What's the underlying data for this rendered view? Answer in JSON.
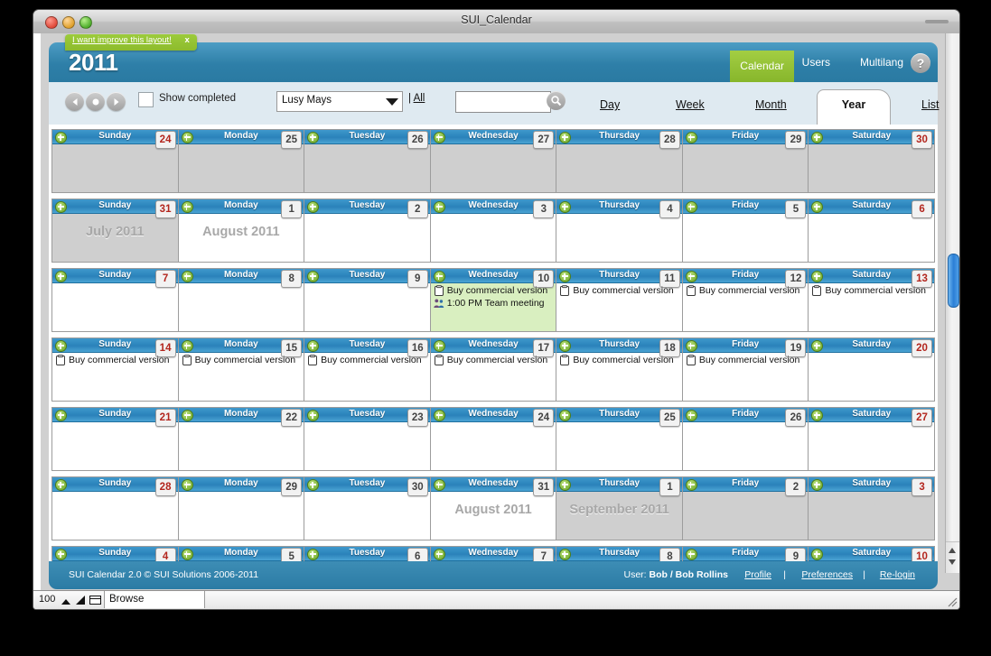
{
  "window": {
    "title": "SUI_Calendar",
    "controls": [
      "close",
      "minimize",
      "maximize"
    ]
  },
  "statusbar": {
    "zoom": "100",
    "mode": "Browse",
    "icons": [
      "zoom-out-icon",
      "zoom-in-icon",
      "toggle-window-icon",
      "resize-grip-icon"
    ]
  },
  "app": {
    "promo": {
      "text": "I want improve this layout!",
      "close": "x"
    },
    "year": "2011",
    "nav": [
      {
        "name": "calendar",
        "label": "Calendar",
        "active": true
      },
      {
        "name": "users",
        "label": "Users",
        "active": false
      },
      {
        "name": "multilang",
        "label": "Multilang",
        "active": false
      }
    ],
    "help_label": "?",
    "toolbar": {
      "prev_icon": "previous-arrow-icon",
      "today_icon": "today-dot-icon",
      "next_icon": "next-arrow-icon",
      "show_completed_label": "Show completed",
      "show_completed_checked": false,
      "user_select_value": "Lusy Mays",
      "user_select_options": [
        "Lusy Mays"
      ],
      "all_link": "| All",
      "all_link_text": "All",
      "search_value": "",
      "search_placeholder": "",
      "search_icon": "search-icon"
    },
    "view_tabs": [
      {
        "name": "day",
        "label": "Day",
        "active": false
      },
      {
        "name": "week",
        "label": "Week",
        "active": false
      },
      {
        "name": "month",
        "label": "Month",
        "active": false
      },
      {
        "name": "year",
        "label": "Year",
        "active": true
      },
      {
        "name": "list",
        "label": "List",
        "active": false
      }
    ],
    "footer": {
      "copyright": "SUI Calendar 2.0 © SUI Solutions 2006-2011",
      "user_prefix": "User:",
      "user_name": "Bob / Bob Rollins",
      "profile": "Profile",
      "sep1": "|",
      "preferences": "Preferences",
      "sep2": "|",
      "relogin": "Re-login"
    }
  },
  "calendar": {
    "daynames": [
      "Sunday",
      "Monday",
      "Tuesday",
      "Wednesday",
      "Thursday",
      "Friday",
      "Saturday"
    ],
    "add_icon": "plus-icon",
    "weeks": [
      {
        "days": [
          {
            "num": "24",
            "state": "grey",
            "weekend": true,
            "month_label": "",
            "events": []
          },
          {
            "num": "25",
            "state": "grey",
            "weekend": false,
            "month_label": "",
            "events": []
          },
          {
            "num": "26",
            "state": "grey",
            "weekend": false,
            "month_label": "",
            "events": []
          },
          {
            "num": "27",
            "state": "grey",
            "weekend": false,
            "month_label": "",
            "events": []
          },
          {
            "num": "28",
            "state": "grey",
            "weekend": false,
            "month_label": "",
            "events": []
          },
          {
            "num": "29",
            "state": "grey",
            "weekend": false,
            "month_label": "",
            "events": []
          },
          {
            "num": "30",
            "state": "grey",
            "weekend": true,
            "month_label": "",
            "events": []
          }
        ]
      },
      {
        "days": [
          {
            "num": "31",
            "state": "grey",
            "weekend": true,
            "month_label": "July 2011",
            "events": []
          },
          {
            "num": "1",
            "state": "normal",
            "weekend": false,
            "month_label": "August 2011",
            "events": []
          },
          {
            "num": "2",
            "state": "normal",
            "weekend": false,
            "month_label": "",
            "events": []
          },
          {
            "num": "3",
            "state": "normal",
            "weekend": false,
            "month_label": "",
            "events": []
          },
          {
            "num": "4",
            "state": "normal",
            "weekend": false,
            "month_label": "",
            "events": []
          },
          {
            "num": "5",
            "state": "normal",
            "weekend": false,
            "month_label": "",
            "events": []
          },
          {
            "num": "6",
            "state": "normal",
            "weekend": true,
            "month_label": "",
            "events": []
          }
        ]
      },
      {
        "days": [
          {
            "num": "7",
            "state": "normal",
            "weekend": true,
            "month_label": "",
            "events": []
          },
          {
            "num": "8",
            "state": "normal",
            "weekend": false,
            "month_label": "",
            "events": []
          },
          {
            "num": "9",
            "state": "normal",
            "weekend": false,
            "month_label": "",
            "events": []
          },
          {
            "num": "10",
            "state": "today",
            "weekend": false,
            "month_label": "",
            "events": [
              {
                "icon": "clipboard-icon",
                "text": "Buy commercial version"
              },
              {
                "icon": "people-icon",
                "text": "1:00 PM Team meeting"
              }
            ]
          },
          {
            "num": "11",
            "state": "normal",
            "weekend": false,
            "month_label": "",
            "events": [
              {
                "icon": "clipboard-icon",
                "text": "Buy commercial version"
              }
            ]
          },
          {
            "num": "12",
            "state": "normal",
            "weekend": false,
            "month_label": "",
            "events": [
              {
                "icon": "clipboard-icon",
                "text": "Buy commercial version"
              }
            ]
          },
          {
            "num": "13",
            "state": "normal",
            "weekend": true,
            "month_label": "",
            "events": [
              {
                "icon": "clipboard-icon",
                "text": "Buy commercial version"
              }
            ]
          }
        ]
      },
      {
        "days": [
          {
            "num": "14",
            "state": "normal",
            "weekend": true,
            "month_label": "",
            "events": [
              {
                "icon": "clipboard-icon",
                "text": "Buy commercial version"
              }
            ]
          },
          {
            "num": "15",
            "state": "normal",
            "weekend": false,
            "month_label": "",
            "events": [
              {
                "icon": "clipboard-icon",
                "text": "Buy commercial version"
              }
            ]
          },
          {
            "num": "16",
            "state": "normal",
            "weekend": false,
            "month_label": "",
            "events": [
              {
                "icon": "clipboard-icon",
                "text": "Buy commercial version"
              }
            ]
          },
          {
            "num": "17",
            "state": "normal",
            "weekend": false,
            "month_label": "",
            "events": [
              {
                "icon": "clipboard-icon",
                "text": "Buy commercial version"
              }
            ]
          },
          {
            "num": "18",
            "state": "normal",
            "weekend": false,
            "month_label": "",
            "events": [
              {
                "icon": "clipboard-icon",
                "text": "Buy commercial version"
              }
            ]
          },
          {
            "num": "19",
            "state": "normal",
            "weekend": false,
            "month_label": "",
            "events": [
              {
                "icon": "clipboard-icon",
                "text": "Buy commercial version"
              }
            ]
          },
          {
            "num": "20",
            "state": "normal",
            "weekend": true,
            "month_label": "",
            "events": []
          }
        ]
      },
      {
        "days": [
          {
            "num": "21",
            "state": "normal",
            "weekend": true,
            "month_label": "",
            "events": []
          },
          {
            "num": "22",
            "state": "normal",
            "weekend": false,
            "month_label": "",
            "events": []
          },
          {
            "num": "23",
            "state": "normal",
            "weekend": false,
            "month_label": "",
            "events": []
          },
          {
            "num": "24",
            "state": "normal",
            "weekend": false,
            "month_label": "",
            "events": []
          },
          {
            "num": "25",
            "state": "normal",
            "weekend": false,
            "month_label": "",
            "events": []
          },
          {
            "num": "26",
            "state": "normal",
            "weekend": false,
            "month_label": "",
            "events": []
          },
          {
            "num": "27",
            "state": "normal",
            "weekend": true,
            "month_label": "",
            "events": []
          }
        ]
      },
      {
        "days": [
          {
            "num": "28",
            "state": "normal",
            "weekend": true,
            "month_label": "",
            "events": []
          },
          {
            "num": "29",
            "state": "normal",
            "weekend": false,
            "month_label": "",
            "events": []
          },
          {
            "num": "30",
            "state": "normal",
            "weekend": false,
            "month_label": "",
            "events": []
          },
          {
            "num": "31",
            "state": "normal",
            "weekend": false,
            "month_label": "August 2011",
            "events": []
          },
          {
            "num": "1",
            "state": "grey",
            "weekend": false,
            "month_label": "September 2011",
            "events": []
          },
          {
            "num": "2",
            "state": "grey",
            "weekend": false,
            "month_label": "",
            "events": []
          },
          {
            "num": "3",
            "state": "grey",
            "weekend": true,
            "month_label": "",
            "events": []
          }
        ]
      },
      {
        "days": [
          {
            "num": "4",
            "state": "grey",
            "weekend": true,
            "month_label": "",
            "events": []
          },
          {
            "num": "5",
            "state": "grey",
            "weekend": false,
            "month_label": "",
            "events": []
          },
          {
            "num": "6",
            "state": "grey",
            "weekend": false,
            "month_label": "",
            "events": []
          },
          {
            "num": "7",
            "state": "grey",
            "weekend": false,
            "month_label": "",
            "events": []
          },
          {
            "num": "8",
            "state": "grey",
            "weekend": false,
            "month_label": "",
            "events": []
          },
          {
            "num": "9",
            "state": "grey",
            "weekend": false,
            "month_label": "",
            "events": []
          },
          {
            "num": "10",
            "state": "grey",
            "weekend": true,
            "month_label": "",
            "events": []
          }
        ]
      }
    ]
  },
  "colors": {
    "header_blue": "#2e7fa8",
    "accent_green": "#8dbb2c",
    "dayheader_blue": "#2d86bd",
    "today_green": "#d9efc0",
    "weekend_red": "#b3261e",
    "scroll_thumb": "#2b7fd6"
  }
}
